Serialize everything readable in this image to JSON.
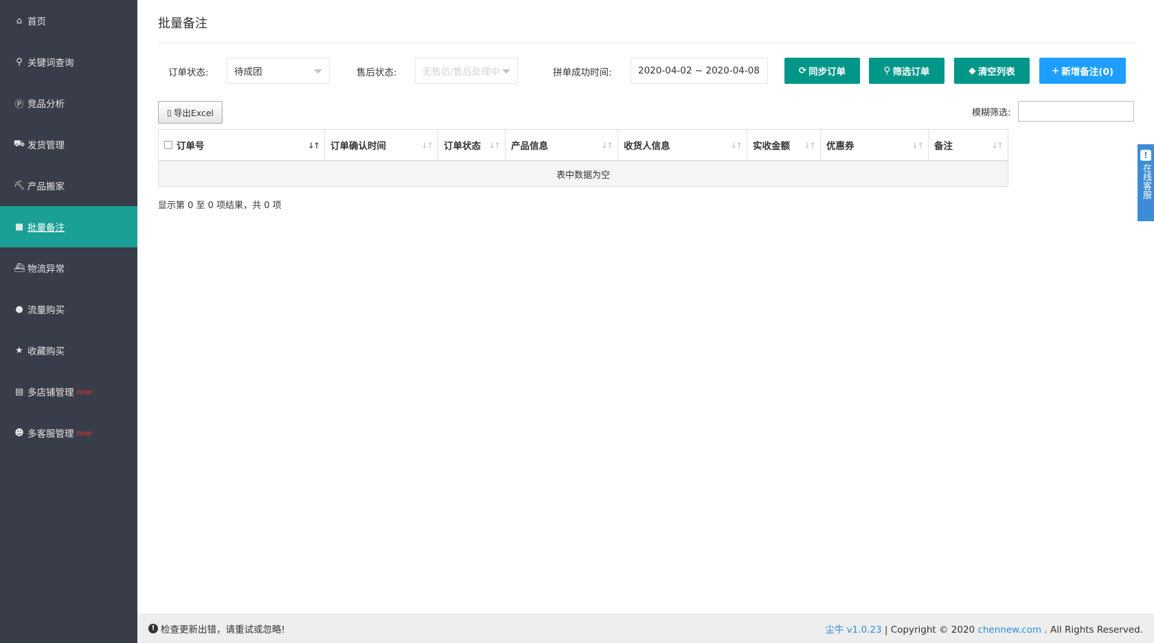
{
  "sidebar": {
    "items": [
      {
        "label": "首页",
        "icon": "home-icon",
        "glyph": "⌂"
      },
      {
        "label": "关键词查询",
        "icon": "search-icon",
        "glyph": "⚲"
      },
      {
        "label": "竞品分析",
        "icon": "p-badge-icon",
        "glyph": "Ⓟ"
      },
      {
        "label": "发货管理",
        "icon": "truck-icon",
        "glyph": "⛟"
      },
      {
        "label": "产品搬家",
        "icon": "cart-icon",
        "glyph": "⛏"
      },
      {
        "label": "批量备注",
        "icon": "book-icon",
        "glyph": "■"
      },
      {
        "label": "物流异常",
        "icon": "ship-icon",
        "glyph": "⛴"
      },
      {
        "label": "流量购买",
        "icon": "bulb-icon",
        "glyph": "●"
      },
      {
        "label": "收藏购买",
        "icon": "star-icon",
        "glyph": "★"
      },
      {
        "label": "多店铺管理",
        "icon": "store-icon",
        "glyph": "▤",
        "badge": "new"
      },
      {
        "label": "多客服管理",
        "icon": "users-icon",
        "glyph": "☻",
        "badge": "new"
      }
    ],
    "active_index": 5
  },
  "page": {
    "title": "批量备注"
  },
  "filters": {
    "order_status_label": "订单状态:",
    "order_status_value": "待成团",
    "aftersale_label": "售后状态:",
    "aftersale_value": "无售后/售后处理中",
    "time_label": "拼单成功时间:",
    "time_value": "2020-04-02 ~ 2020-04-08"
  },
  "buttons": {
    "sync": "同步订单",
    "filter": "筛选订单",
    "clear": "清空列表",
    "add_note": "新增备注(0)",
    "export": "导出Excel"
  },
  "fuzzy": {
    "label": "模糊筛选:",
    "value": ""
  },
  "table": {
    "columns": [
      "订单号",
      "订单确认时间",
      "订单状态",
      "产品信息",
      "收货人信息",
      "实收金额",
      "优惠券",
      "备注"
    ],
    "empty_text": "表中数据为空",
    "info": "显示第 0 至 0 项结果，共 0 项"
  },
  "float_service": {
    "text": "在线客服"
  },
  "footer": {
    "warning": "检查更新出错，请重试或忽略!",
    "app_name": "尘牛",
    "version": "v1.0.23",
    "copyright_pre": "| Copyright © 2020",
    "site": "chennew.com",
    "copyright_post": ". All Rights Reserved."
  },
  "colors": {
    "sidebar_bg": "#393d49",
    "active_bg": "#1aa094",
    "btn_green": "#009688",
    "btn_blue": "#1e9fff",
    "link": "#2d8cd8",
    "new_badge": "#e5352b"
  }
}
